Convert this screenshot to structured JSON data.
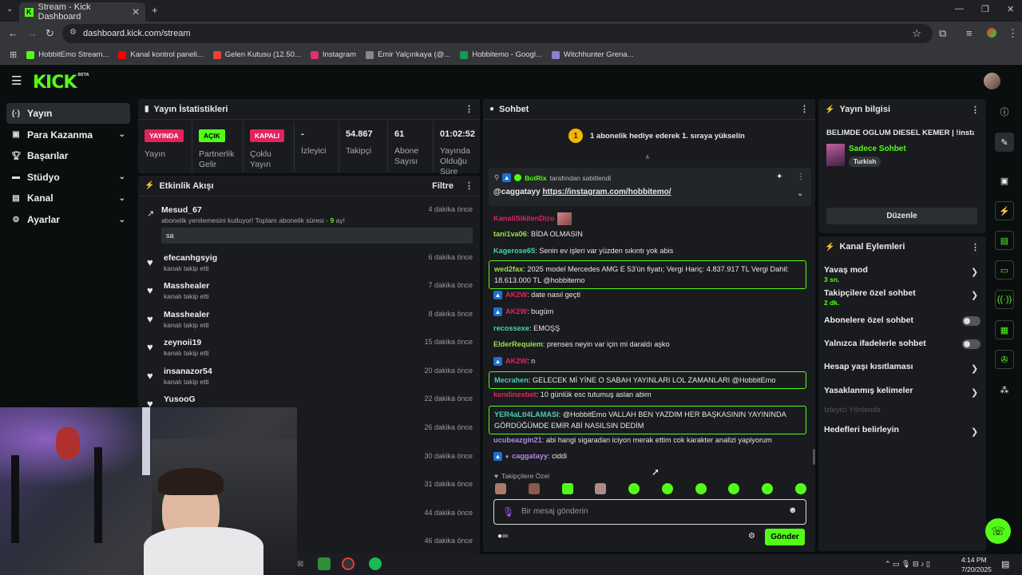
{
  "browser": {
    "tab_title": "Stream - Kick Dashboard",
    "url": "dashboard.kick.com/stream",
    "bookmarks": [
      {
        "label": "HobbitEmo Stream...",
        "color": "#53fc18"
      },
      {
        "label": "Kanal kontrol paneli...",
        "color": "#ff0000"
      },
      {
        "label": "Gelen Kutusu (12.50...",
        "color": "#ea4335"
      },
      {
        "label": "Instagram",
        "color": "#e1306c"
      },
      {
        "label": "Emir Yalçınkaya (@...",
        "color": "#888888"
      },
      {
        "label": "Hobbitemo - Googl...",
        "color": "#0f9d58"
      },
      {
        "label": "Witchhunter Grena...",
        "color": "#8a7fd0"
      }
    ]
  },
  "brand": {
    "logo": "KICK",
    "beta": "BETA",
    "accent": "#53fc18"
  },
  "sidebar": {
    "items": [
      {
        "label": "Yayın",
        "icon": "broadcast-icon"
      },
      {
        "label": "Para Kazanma",
        "icon": "money-icon"
      },
      {
        "label": "Başarılar",
        "icon": "trophy-icon"
      },
      {
        "label": "Stüdyo",
        "icon": "studio-icon"
      },
      {
        "label": "Kanal",
        "icon": "channel-icon"
      },
      {
        "label": "Ayarlar",
        "icon": "settings-icon"
      }
    ]
  },
  "stats": {
    "title": "Yayın İstatistikleri",
    "cells": [
      {
        "badge": "YAYINDA",
        "label": "Yayın"
      },
      {
        "badge": "AÇIK",
        "label": "Partnerlik Gelir"
      },
      {
        "badge": "KAPALI",
        "label": "Çoklu Yayın"
      },
      {
        "value": "-",
        "label": "İzleyici"
      },
      {
        "value": "54.867",
        "label": "Takipçi"
      },
      {
        "value": "61",
        "label": "Abone Sayısı"
      },
      {
        "value": "01:02:52",
        "label": "Yayında Olduğu Süre"
      }
    ]
  },
  "activity": {
    "title": "Etkinlik Akışı",
    "filter": "Filtre",
    "events": [
      {
        "name": "Mesud_67",
        "sub": "abonelik yenilemesini kutluyor! Toplam abonelik süresi - ",
        "months": "9",
        "sub_end": " ay!",
        "time": "4 dakika önce",
        "note": "sa"
      },
      {
        "name": "efecanhgsyig",
        "sub": "kanalı takip etti",
        "time": "6 dakika önce"
      },
      {
        "name": "Masshealer",
        "sub": "kanalı takip etti",
        "time": "7 dakika önce"
      },
      {
        "name": "Masshealer",
        "sub": "kanalı takip etti",
        "time": "8 dakika önce"
      },
      {
        "name": "zeynoii19",
        "sub": "kanalı takip etti",
        "time": "15 dakika önce"
      },
      {
        "name": "insanazor54",
        "sub": "kanalı takip etti",
        "time": "20 dakika önce"
      },
      {
        "name": "YusooG",
        "sub": "",
        "time": "22 dakika önce"
      },
      {
        "time": "26 dakika önce"
      },
      {
        "time": "30 dakika önce"
      },
      {
        "time": "31 dakika önce"
      },
      {
        "time": "44 dakika önce"
      },
      {
        "time": "46 dakika önce"
      }
    ]
  },
  "chat": {
    "title": "Sohbet",
    "gift_banner": "1 abonelik hediye ederek 1. sıraya yükselin",
    "gift_rank": "1",
    "pinned": {
      "by_user": "BotRix",
      "by_text": "tarafından sabitlendi",
      "mention": "@caggatayy",
      "link": "https://instagram.com/hobbitemo/"
    },
    "messages": [
      {
        "user": "KanaliSikilenDizo",
        "color": "#e0245e",
        "text": ""
      },
      {
        "user": "tani1va06",
        "color": "#9be04a",
        "text": "BİDA OLMASIN"
      },
      {
        "user": "Kagerose65",
        "color": "#4ad0b0",
        "text": "Senin ev işleri var yüzden sıkıntı yok abis"
      },
      {
        "user": "wed2fax",
        "color": "#9be04a",
        "text": "2025 model Mercedes AMG E 53'ün fiyatı; Vergi Hariç: 4.837.917 TL Vergi Dahil: 18.613.000 TL @hobbitemo"
      },
      {
        "user": "AK2W",
        "color": "#e0245e",
        "text": "date nasıl geçti"
      },
      {
        "user": "AK2W",
        "color": "#e0245e",
        "text": "bugüm"
      },
      {
        "user": "recossexe",
        "color": "#4ad0b0",
        "text": "EMOŞŞ"
      },
      {
        "user": "ElderRequiem",
        "color": "#9be04a",
        "text": "prenses neyin var için mi daraldı aşko"
      },
      {
        "user": "AK2W",
        "color": "#e0245e",
        "text": "n"
      },
      {
        "user": "Mecrahen",
        "color": "#4ad0b0",
        "text": "GELECEK Mİ YİNE O SABAH YAYINLARI LOL ZAMANLARI @HobbitEmo"
      },
      {
        "user": "kendinexbet",
        "color": "#e0245e",
        "text": "10 günlük esc tutumuş aslan abim"
      },
      {
        "user": "YER4aLtI4LAMASI",
        "color": "#4ad0b0",
        "text": "@HobbitEmo VALLAH BEN YAZDIM HER BAŞKASININ YAYININDA GÖRDÜĞÜMDE EMİR ABİ NASILSIN DEDİM"
      },
      {
        "user": "ucubeazgin21",
        "color": "#b08ae0",
        "text": "abi hangi sigaradan iciyon merak ettim cok karakter analizi yapiyorum"
      },
      {
        "user": "caggatayy",
        "color": "#b08ae0",
        "text": "ciddi"
      }
    ],
    "followers_only": "Takipçilere Özel",
    "input_placeholder": "Bir mesaj gönderin",
    "send_label": "Gönder"
  },
  "stream_info": {
    "title": "Yayın bilgisi",
    "stream_title": "BELIMDE OGLUM DIESEL KEMER | !insta",
    "category": "Sadece Sohbet",
    "tag": "Turkish",
    "edit_label": "Düzenle"
  },
  "channel_actions": {
    "title": "Kanal Eylemleri",
    "items": [
      {
        "label": "Yavaş mod",
        "sub": "3 sn.",
        "type": "chevron"
      },
      {
        "label": "Takipçilere özel sohbet",
        "sub": "2 dk.",
        "type": "chevron"
      },
      {
        "label": "Abonelere özel sohbet",
        "type": "toggle"
      },
      {
        "label": "Yalnızca ifadelerle sohbet",
        "type": "toggle"
      },
      {
        "label": "Hesap yaşı kısıtlaması",
        "type": "chevron"
      },
      {
        "label": "Yasaklanmış kelimeler",
        "type": "chevron"
      },
      {
        "label": "İzleyici Yönlendir",
        "type": "disabled"
      },
      {
        "label": "Hedefleri belirleyin",
        "type": "chevron"
      }
    ]
  },
  "taskbar": {
    "time": "4:14 PM",
    "date": "7/20/2025"
  }
}
